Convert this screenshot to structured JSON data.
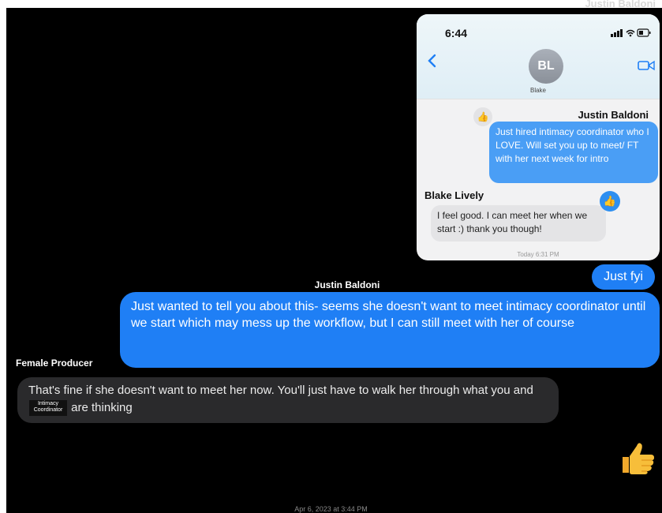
{
  "top_label": "Justin Baldoni",
  "phone": {
    "time": "6:44",
    "avatar_initials": "BL",
    "contact_name": "Blake",
    "msg1_sender": "Justin Baldoni",
    "msg1_text": "Just hired intimacy coordinator who I LOVE. Will set you up to meet/ FT with her next week for intro",
    "msg2_sender": "Blake Lively",
    "msg2_text": "I feel good. I can meet her when we start :) thank you though!",
    "stamp": "Today 6:31 PM"
  },
  "chat": {
    "fyi_text": "Just fyi",
    "sender_justin": "Justin Baldoni",
    "justin_msg": "Just wanted to tell you about this- seems she doesn't want to meet intimacy coordinator until we start which may mess up the workflow, but I can still meet with her of course",
    "sender_producer": "Female Producer",
    "producer_msg_part1": "That's fine if she doesn't want to meet her now. You'll just have to walk her through what you and",
    "redaction_tag_line1": "Intimacy",
    "redaction_tag_line2": "Coordinator",
    "producer_msg_part2": "are thinking",
    "date": "Apr 6, 2023 at 3:44 PM"
  },
  "icons": {
    "back": "chevron-left-icon",
    "video": "video-camera-icon",
    "signal": "signal-icon",
    "wifi": "wifi-icon",
    "battery": "battery-icon",
    "tapback": "thumbs-up-icon",
    "reaction": "thumbs-up-emoji-icon"
  },
  "colors": {
    "imessage_blue": "#1f7ff5",
    "incoming_grey": "#2a2a2c",
    "background": "#000000"
  }
}
